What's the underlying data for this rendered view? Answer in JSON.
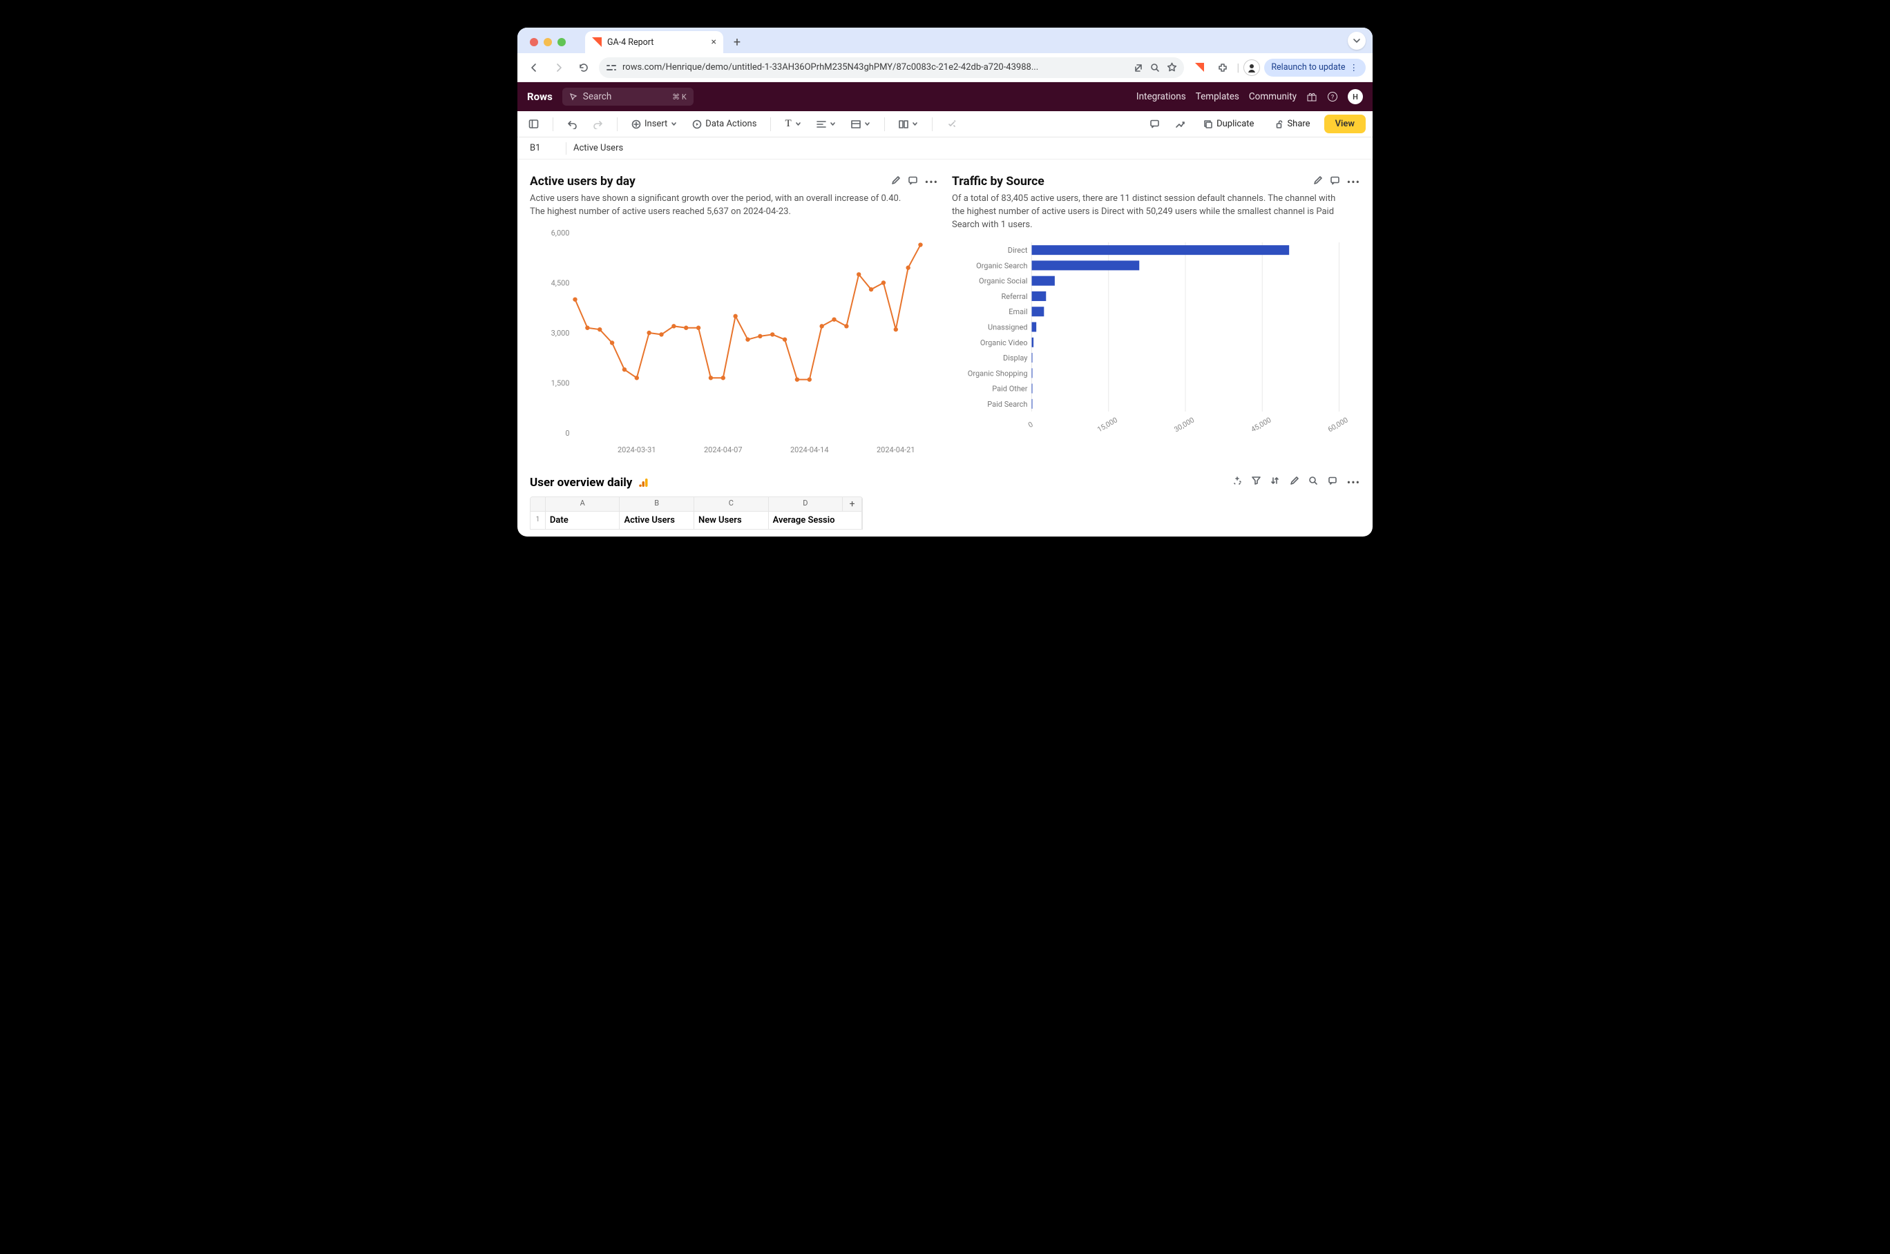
{
  "browser": {
    "tab_title": "GA-4 Report",
    "url": "rows.com/Henrique/demo/untitled-1-33AH36OPrhM235N43ghPMY/87c0083c-21e2-42db-a720-43988...",
    "relaunch_label": "Relaunch to update"
  },
  "app": {
    "brand": "Rows",
    "search_placeholder": "Search",
    "search_shortcut": "⌘ K",
    "nav": {
      "integrations": "Integrations",
      "templates": "Templates",
      "community": "Community"
    },
    "user_initial": "H"
  },
  "toolbar": {
    "insert": "Insert",
    "data_actions": "Data Actions",
    "duplicate": "Duplicate",
    "share": "Share",
    "view": "View"
  },
  "formula_bar": {
    "cell": "B1",
    "value": "Active Users"
  },
  "panels": {
    "left": {
      "title": "Active users by day",
      "desc": "Active users have shown a significant growth over the period, with an overall increase of 0.40. The highest number of active users reached 5,637 on 2024-04-23."
    },
    "right": {
      "title": "Traffic by Source",
      "desc": "Of a total of 83,405 active users, there are 11 distinct session default channels. The channel with the highest number of active users is Direct with 50,249 users while the smallest channel is Paid Search with 1 users."
    }
  },
  "overview": {
    "title": "User overview daily",
    "cols": [
      "A",
      "B",
      "C",
      "D"
    ],
    "headers": [
      "Date",
      "Active Users",
      "New Users",
      "Average Sessio"
    ],
    "row_num": "1",
    "add": "+"
  },
  "chart_data": [
    {
      "type": "line",
      "title": "Active users by day",
      "xlabel": "",
      "ylabel": "",
      "ylim": [
        0,
        6000
      ],
      "y_ticks": [
        0,
        1500,
        3000,
        4500,
        6000
      ],
      "x_tick_labels": [
        "2024-03-31",
        "2024-04-07",
        "2024-04-14",
        "2024-04-21"
      ],
      "x": [
        "2024-03-26",
        "2024-03-27",
        "2024-03-28",
        "2024-03-29",
        "2024-03-30",
        "2024-03-31",
        "2024-04-01",
        "2024-04-02",
        "2024-04-03",
        "2024-04-04",
        "2024-04-05",
        "2024-04-06",
        "2024-04-07",
        "2024-04-08",
        "2024-04-09",
        "2024-04-10",
        "2024-04-11",
        "2024-04-12",
        "2024-04-13",
        "2024-04-14",
        "2024-04-15",
        "2024-04-16",
        "2024-04-17",
        "2024-04-18",
        "2024-04-19",
        "2024-04-20",
        "2024-04-21",
        "2024-04-22",
        "2024-04-23"
      ],
      "values": [
        4000,
        3150,
        3100,
        2700,
        1900,
        1650,
        3000,
        2950,
        3200,
        3150,
        3150,
        1650,
        1650,
        3500,
        2800,
        2900,
        2950,
        2800,
        1600,
        1600,
        3200,
        3400,
        3200,
        4750,
        4300,
        4500,
        3100,
        4950,
        5637
      ]
    },
    {
      "type": "bar",
      "orientation": "horizontal",
      "title": "Traffic by Source",
      "xlim": [
        0,
        60000
      ],
      "x_ticks": [
        0,
        15000,
        30000,
        45000,
        60000
      ],
      "categories": [
        "Direct",
        "Organic Search",
        "Organic Social",
        "Referral",
        "Email",
        "Unassigned",
        "Organic Video",
        "Display",
        "Organic Shopping",
        "Paid Other",
        "Paid Search"
      ],
      "values": [
        50249,
        21000,
        4500,
        2800,
        2400,
        900,
        350,
        40,
        10,
        5,
        1
      ]
    }
  ]
}
